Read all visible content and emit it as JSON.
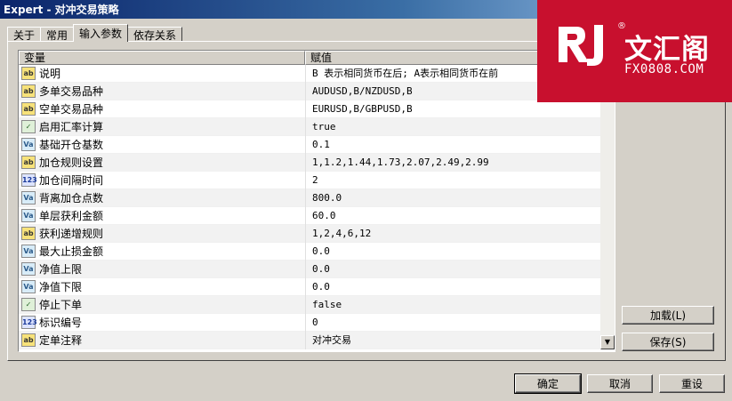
{
  "window": {
    "title": "Expert - 对冲交易策略"
  },
  "tabs": [
    {
      "label": "关于"
    },
    {
      "label": "常用"
    },
    {
      "label": "输入参数",
      "active": true
    },
    {
      "label": "依存关系"
    }
  ],
  "grid": {
    "headers": [
      "变量",
      "赋值"
    ],
    "rows": [
      {
        "type": "string",
        "icon": "ab",
        "name": "说明",
        "value": "B 表示相同货币在后; A表示相同货币在前"
      },
      {
        "type": "string",
        "icon": "ab",
        "name": "多单交易品种",
        "value": "AUDUSD,B/NZDUSD,B"
      },
      {
        "type": "string",
        "icon": "ab",
        "name": "空单交易品种",
        "value": "EURUSD,B/GBPUSD,B"
      },
      {
        "type": "bool",
        "icon": "✓",
        "name": "启用汇率计算",
        "value": "true"
      },
      {
        "type": "double",
        "icon": "Va",
        "name": "基础开仓基数",
        "value": "0.1"
      },
      {
        "type": "string",
        "icon": "ab",
        "name": "加仓规则设置",
        "value": "1,1.2,1.44,1.73,2.07,2.49,2.99"
      },
      {
        "type": "int",
        "icon": "123",
        "name": "加仓间隔时间",
        "value": "2"
      },
      {
        "type": "double",
        "icon": "Va",
        "name": "背离加仓点数",
        "value": "800.0"
      },
      {
        "type": "double",
        "icon": "Va",
        "name": "单层获利金额",
        "value": "60.0"
      },
      {
        "type": "string",
        "icon": "ab",
        "name": "获利递增规则",
        "value": "1,2,4,6,12"
      },
      {
        "type": "double",
        "icon": "Va",
        "name": "最大止损金额",
        "value": "0.0"
      },
      {
        "type": "double",
        "icon": "Va",
        "name": "净值上限",
        "value": "0.0"
      },
      {
        "type": "double",
        "icon": "Va",
        "name": "净值下限",
        "value": "0.0"
      },
      {
        "type": "bool",
        "icon": "✓",
        "name": "停止下单",
        "value": "false"
      },
      {
        "type": "int",
        "icon": "123",
        "name": "标识编号",
        "value": "0"
      },
      {
        "type": "string",
        "icon": "ab",
        "name": "定单注释",
        "value": "对冲交易"
      }
    ]
  },
  "side_buttons": {
    "load": "加载(L)",
    "save": "保存(S)"
  },
  "footer_buttons": {
    "ok": "确定",
    "cancel": "取消",
    "reset": "重设"
  },
  "watermark": {
    "brand": "文汇阁",
    "url": "FX0808.COM",
    "reg": "®",
    "color": "#c8102e"
  }
}
